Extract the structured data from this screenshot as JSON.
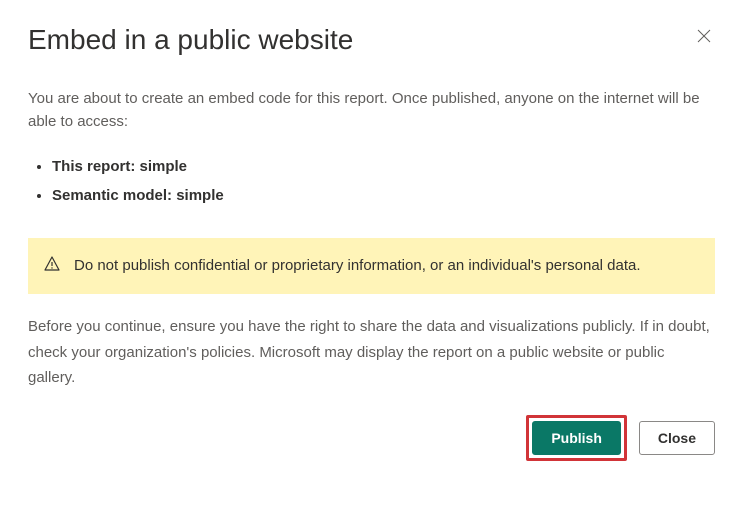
{
  "dialog": {
    "title": "Embed in a public website",
    "intro": "You are about to create an embed code for this report. Once published, anyone on the internet will be able to access:",
    "items": [
      "This report: simple",
      "Semantic model: simple"
    ],
    "warning": {
      "text": "Do not publish confidential or proprietary information, or an individual's personal data."
    },
    "disclaimer": "Before you continue, ensure you have the right to share the data and visualizations publicly. If in doubt, check your organization's policies. Microsoft may display the report on a public website or public gallery.",
    "buttons": {
      "publish": "Publish",
      "close": "Close"
    }
  }
}
